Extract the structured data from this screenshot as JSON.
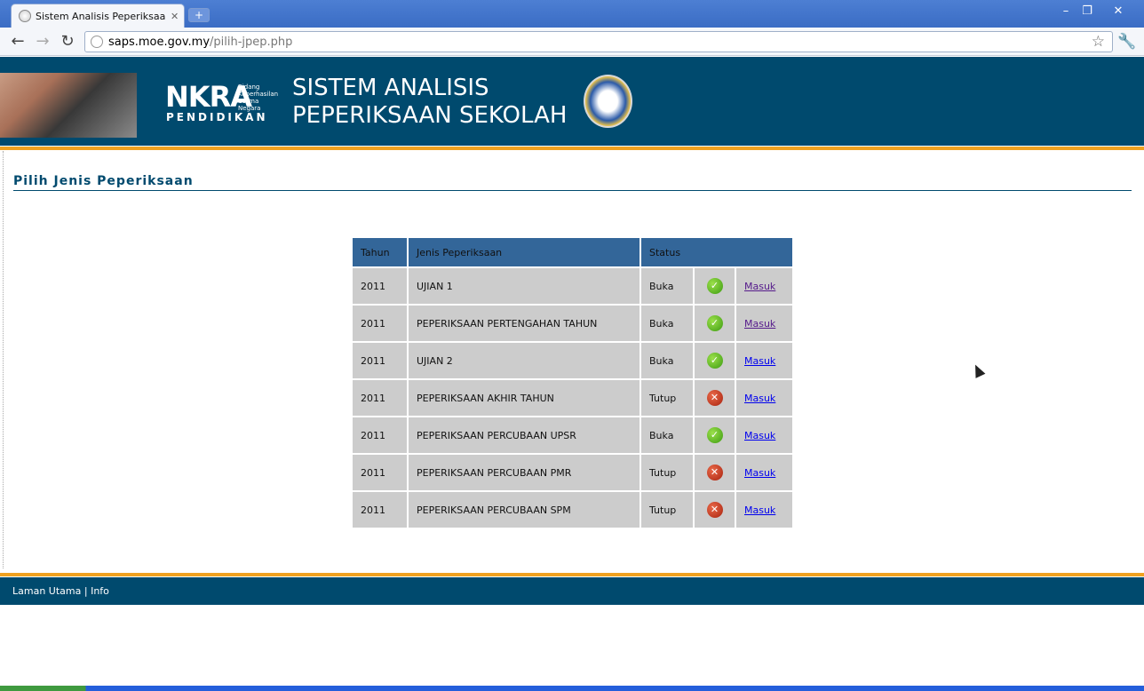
{
  "browser": {
    "tab_title": "Sistem Analisis Peperiksaan Se",
    "new_tab": "+",
    "url_host": "saps.moe.gov.my",
    "url_path": "/pilih-jpep.php"
  },
  "header": {
    "logo_text": "NKRA",
    "logo_sub": "Bidang Keberhasilan Utama Negara",
    "logo_bottom": "PENDIDIKAN",
    "title_line1": "SISTEM ANALISIS",
    "title_line2": "PEPERIKSAAN SEKOLAH"
  },
  "main": {
    "section_title": "Pilih Jenis Peperiksaan",
    "table": {
      "headers": {
        "year": "Tahun",
        "exam": "Jenis Peperiksaan",
        "status": "Status"
      },
      "rows": [
        {
          "year": "2011",
          "exam": "UJIAN 1",
          "status": "Buka",
          "state": "ok",
          "link": "Masuk"
        },
        {
          "year": "2011",
          "exam": "PEPERIKSAAN PERTENGAHAN TAHUN",
          "status": "Buka",
          "state": "ok",
          "link": "Masuk"
        },
        {
          "year": "2011",
          "exam": "UJIAN 2",
          "status": "Buka",
          "state": "ok",
          "link": "Masuk"
        },
        {
          "year": "2011",
          "exam": "PEPERIKSAAN AKHIR TAHUN",
          "status": "Tutup",
          "state": "closed",
          "link": "Masuk"
        },
        {
          "year": "2011",
          "exam": "PEPERIKSAAN PERCUBAAN UPSR",
          "status": "Buka",
          "state": "ok",
          "link": "Masuk"
        },
        {
          "year": "2011",
          "exam": "PEPERIKSAAN PERCUBAAN PMR",
          "status": "Tutup",
          "state": "closed",
          "link": "Masuk"
        },
        {
          "year": "2011",
          "exam": "PEPERIKSAAN PERCUBAAN SPM",
          "status": "Tutup",
          "state": "closed",
          "link": "Masuk"
        }
      ]
    }
  },
  "footer": {
    "home": "Laman Utama",
    "separator": "|",
    "info": "Info"
  },
  "colors": {
    "header_bg": "#004a6e",
    "accent_orange": "#f0a11f",
    "table_header": "#336699",
    "table_cell": "#cccccc"
  }
}
